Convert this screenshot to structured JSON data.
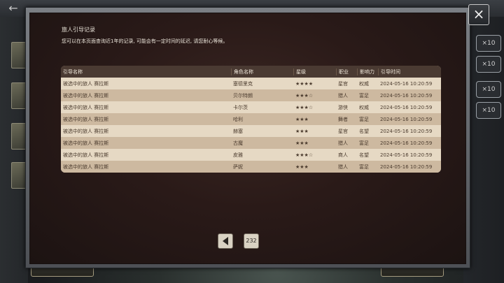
{
  "modal": {
    "title": "旅人引导记录",
    "subtitle": "您可以在本页面查询近1年的记录, 可能会有一定时间的延迟, 请您耐心等候。",
    "close_icon": "×"
  },
  "table": {
    "headers": [
      "引导名称",
      "角色名称",
      "星级",
      "职业",
      "影响力",
      "引导时间"
    ],
    "rows": [
      [
        "被选中的旅人 赛拉斯",
        "塞德里克",
        "★★★★",
        "星官",
        "权威",
        "2024-05-16 10:20:59"
      ],
      [
        "被选中的旅人 赛拉斯",
        "贝尔特朗",
        "★★★☆",
        "猎人",
        "富足",
        "2024-05-16 10:20:59"
      ],
      [
        "被选中的旅人 赛拉斯",
        "卡尔茨",
        "★★★☆",
        "游侠",
        "权威",
        "2024-05-16 10:20:59"
      ],
      [
        "被选中的旅人 赛拉斯",
        "哈利",
        "★★★",
        "舞者",
        "富足",
        "2024-05-16 10:20:59"
      ],
      [
        "被选中的旅人 赛拉斯",
        "赫塞",
        "★★★",
        "星官",
        "名望",
        "2024-05-16 10:20:59"
      ],
      [
        "被选中的旅人 赛拉斯",
        "古魔",
        "★★★",
        "猎人",
        "富足",
        "2024-05-16 10:20:59"
      ],
      [
        "被选中的旅人 赛拉斯",
        "皮雅",
        "★★★☆",
        "商人",
        "名望",
        "2024-05-16 10:20:59"
      ],
      [
        "被选中的旅人 赛拉斯",
        "萨妮",
        "★★★",
        "猎人",
        "富足",
        "2024-05-16 10:20:59"
      ]
    ]
  },
  "pagination": {
    "prev_icon": "chevron-left-icon",
    "page": "232"
  },
  "background": {
    "chips": [
      "×10",
      "×10",
      "×10",
      "×10"
    ]
  },
  "colors": {
    "header_bg": "#4a3a32",
    "row_light": "#e6d9c4",
    "row_dark": "#cdb9a0",
    "modal_bg": "#2a1a18"
  }
}
